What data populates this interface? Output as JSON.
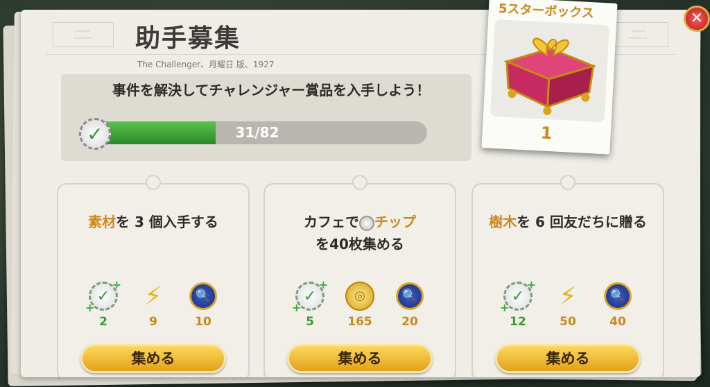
{
  "header": {
    "title": "助手募集",
    "byline": "The Challenger、月曜日 版、1927"
  },
  "challenge": {
    "text": "事件を解決してチャレンジャー賞品を入手しよう！",
    "progress_text": "31/82",
    "progress_current": 31,
    "progress_total": 82
  },
  "reward": {
    "title": "5スターボックス",
    "count": "1",
    "accent": "#c9891e"
  },
  "tasks": [
    {
      "desc_highlight": "素材",
      "desc_rest": "を 3 個入手する",
      "rewards": [
        {
          "icon": "check-plus-icon",
          "value": "2"
        },
        {
          "icon": "energy-bolt-icon",
          "value": "9"
        },
        {
          "icon": "detective-medal-icon",
          "value": "10"
        }
      ],
      "button": "集める"
    },
    {
      "desc_pre": "カフェで",
      "desc_highlight": "チップ",
      "desc_rest": "を40枚集める",
      "rewards": [
        {
          "icon": "check-plus-icon",
          "value": "5"
        },
        {
          "icon": "gold-coin-icon",
          "value": "165"
        },
        {
          "icon": "detective-medal-icon",
          "value": "20"
        }
      ],
      "button": "集める"
    },
    {
      "desc_highlight": "樹木",
      "desc_rest": "を 6 回友だちに贈る",
      "rewards": [
        {
          "icon": "check-plus-icon",
          "value": "12"
        },
        {
          "icon": "energy-bolt-icon",
          "value": "50"
        },
        {
          "icon": "detective-medal-icon",
          "value": "40"
        }
      ],
      "button": "集める"
    }
  ],
  "colors": {
    "progress_green": "#3aa83a",
    "gold": "#c9891e",
    "button_gold": "#f0be3a",
    "close_red": "#d22b2b"
  }
}
